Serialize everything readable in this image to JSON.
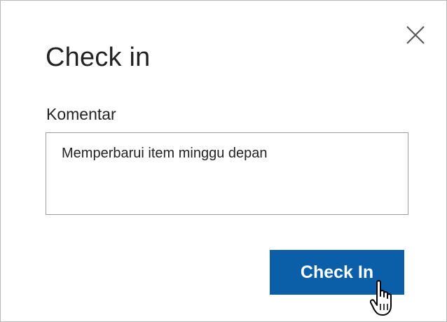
{
  "dialog": {
    "title": "Check in",
    "comment_label": "Komentar",
    "comment_value": "Memperbarui item minggu depan",
    "submit_label": "Check In",
    "close_icon": "close-icon",
    "cursor_icon": "hand-pointer-icon"
  },
  "colors": {
    "accent": "#0a5fa8",
    "text": "#222222",
    "border": "#9e9e9e"
  }
}
